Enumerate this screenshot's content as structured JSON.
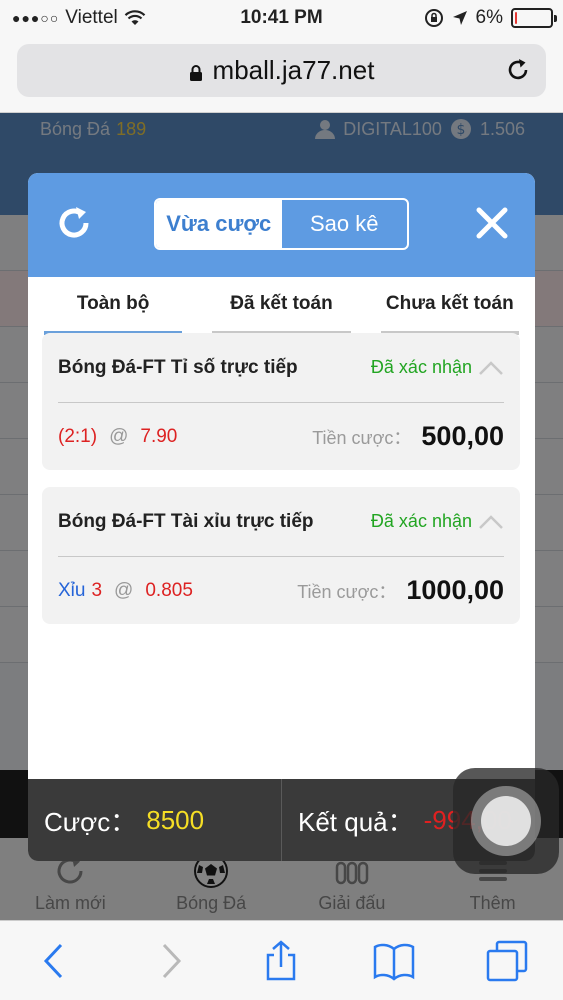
{
  "status_bar": {
    "carrier": "Viettel",
    "time": "10:41 PM",
    "battery": "6%",
    "battery_level": 0.06
  },
  "browser": {
    "url": "mball.ja77.net"
  },
  "background_page": {
    "sport_label": "Bóng Đá",
    "sport_count": "189",
    "username": "DIGITAL100",
    "balance": "1.506",
    "nav": [
      {
        "label": "Làm mới",
        "icon": "refresh-icon"
      },
      {
        "label": "Bóng Đá",
        "icon": "soccer-ball-icon"
      },
      {
        "label": "Giải đấu",
        "icon": "league-icon"
      },
      {
        "label": "Thêm",
        "icon": "menu-icon"
      }
    ]
  },
  "modal": {
    "segments": {
      "active": "Vừa cược",
      "inactive": "Sao kê"
    },
    "tabs": [
      "Toàn bộ",
      "Đã kết toán",
      "Chưa kết toán"
    ],
    "bets": [
      {
        "title": "Bóng Đá-FT Tỉ số trực tiếp",
        "status": "Đã xác nhận",
        "pick_main": "(2:1)",
        "at": "@",
        "odds": "7.90",
        "stake_label": "Tiền cược",
        "stake": "500,00"
      },
      {
        "title": "Bóng Đá-FT Tài xỉu trực tiếp",
        "status": "Đã xác nhận",
        "pick_label": "Xỉu",
        "pick_value": "3",
        "at": "@",
        "odds": "0.805",
        "stake_label": "Tiền cược",
        "stake": "1000,00"
      }
    ],
    "footer": {
      "bet_label": "Cược：",
      "bet_value": "8500",
      "result_label": "Kết quả：",
      "result_value": "-994,00"
    }
  },
  "colors": {
    "modal_header": "#5e9be2",
    "confirmed": "#22a522",
    "odds_red": "#d22222",
    "footer_yellow": "#f5de25"
  }
}
